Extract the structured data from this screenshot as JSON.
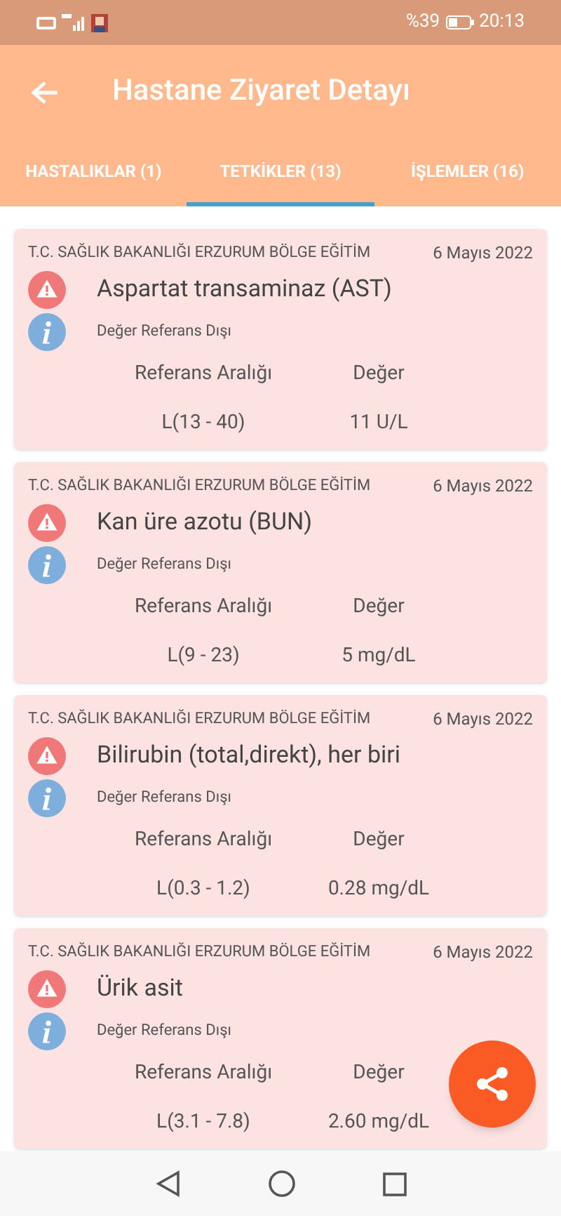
{
  "status_bar": {
    "battery": "%39",
    "time": "20:13"
  },
  "app_bar": {
    "title": "Hastane Ziyaret Detayı"
  },
  "tabs": [
    {
      "label": "HASTALIKLAR (1)",
      "selected": false
    },
    {
      "label": "TETKİKLER (13)",
      "selected": true
    },
    {
      "label": "İŞLEMLER (16)",
      "selected": false
    }
  ],
  "tests": [
    {
      "institution": "T.C. SAĞLIK BAKANLIĞI ERZURUM BÖLGE EĞİTİM",
      "date": "6 Mayıs 2022",
      "name": "Aspartat transaminaz (AST)",
      "note": "Değer Referans Dışı",
      "range_label": "Referans Aralığı",
      "value_label": "Değer",
      "range": "L(13 - 40)",
      "value": "11 U/L"
    },
    {
      "institution": "T.C. SAĞLIK BAKANLIĞI ERZURUM BÖLGE EĞİTİM",
      "date": "6 Mayıs 2022",
      "name": "Kan üre azotu (BUN)",
      "note": "Değer Referans Dışı",
      "range_label": "Referans Aralığı",
      "value_label": "Değer",
      "range": "L(9 - 23)",
      "value": "5 mg/dL"
    },
    {
      "institution": "T.C. SAĞLIK BAKANLIĞI ERZURUM BÖLGE EĞİTİM",
      "date": "6 Mayıs 2022",
      "name": "Bilirubin (total,direkt), her biri",
      "note": "Değer Referans Dışı",
      "range_label": "Referans Aralığı",
      "value_label": "Değer",
      "range": "L(0.3 - 1.2)",
      "value": "0.28 mg/dL"
    },
    {
      "institution": "T.C. SAĞLIK BAKANLIĞI ERZURUM BÖLGE EĞİTİM",
      "date": "6 Mayıs 2022",
      "name": "Ürik asit",
      "note": "Değer Referans Dışı",
      "range_label": "Referans Aralığı",
      "value_label": "Değer",
      "range": "L(3.1 - 7.8)",
      "value": "2.60 mg/dL"
    }
  ]
}
